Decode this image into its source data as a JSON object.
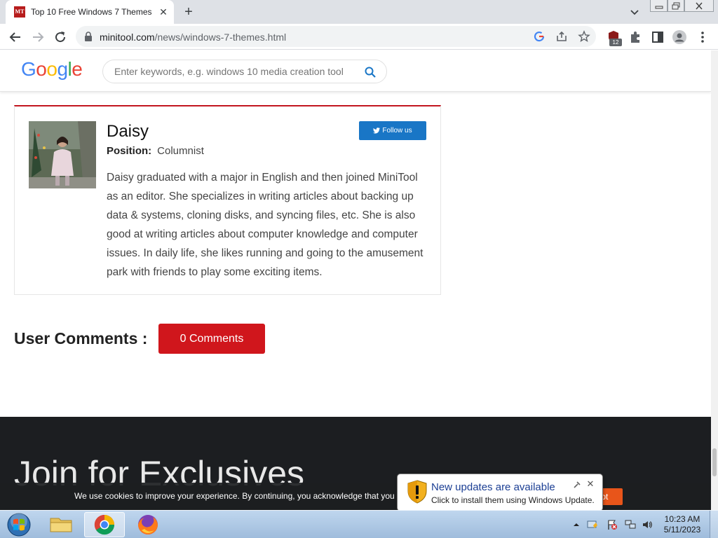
{
  "browser": {
    "tab": {
      "favicon_text": "MT",
      "title": "Top 10 Free Windows 7 Themes f"
    },
    "url": {
      "domain": "minitool.com",
      "path": "/news/windows-7-themes.html"
    },
    "extension_badge": "12"
  },
  "site": {
    "logo": {
      "letters": [
        "G",
        "o",
        "o",
        "g",
        "l",
        "e"
      ],
      "colors": [
        "#4285F4",
        "#EA4335",
        "#FBBC05",
        "#4285F4",
        "#34A853",
        "#EA4335"
      ]
    },
    "search": {
      "placeholder": "Enter keywords, e.g. windows 10 media creation tool"
    }
  },
  "author": {
    "name": "Daisy",
    "follow_label": "Follow us",
    "position_label": "Position:",
    "position_value": "Columnist",
    "bio": "Daisy graduated with a major in English and then joined MiniTool as an editor. She specializes in writing articles about backing up data & systems, cloning disks, and syncing files, etc. She is also good at writing articles about computer knowledge and computer issues. In daily life, she likes running and going to the amusement park with friends to play some exciting items."
  },
  "comments": {
    "title": "User Comments :",
    "button_label": "0 Comments"
  },
  "footer": {
    "join_title": "Join for Exclusives"
  },
  "cookie": {
    "text": "We use cookies to improve your experience. By continuing, you acknowledge that you h",
    "accept_label": "ept"
  },
  "notification": {
    "title": "New updates are available",
    "text": "Click to install them using Windows Update."
  },
  "taskbar": {
    "time": "10:23 AM",
    "date": "5/11/2023"
  },
  "colors": {
    "accent_red": "#c2151f",
    "comments_button": "#d0161c",
    "follow_button": "#1976c6",
    "accept_button": "#e8551a"
  }
}
